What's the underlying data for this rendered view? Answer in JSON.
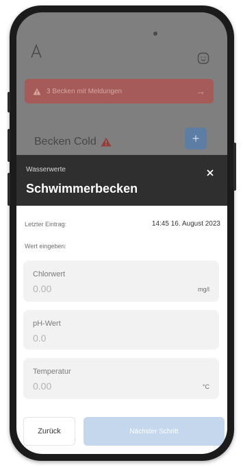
{
  "colors": {
    "accent": "#c5d7ec",
    "alert": "#a55b58",
    "header": "#2f2f2f",
    "field_bg": "#f2f2f2"
  },
  "background": {
    "logo_icon": "brand-logo-icon",
    "avatar_icon": "avatar-icon",
    "alert_text": "3 Becken mit Meldungen",
    "alert_arrow": "→",
    "pool_name": "Becken Cold",
    "add_label": "+"
  },
  "sheet": {
    "subtitle": "Wasserwerte",
    "title": "Schwimmerbecken",
    "close_icon": "close-icon",
    "last_entry_label": "Letzter Eintrag:",
    "last_entry_value": "14:45 16. August 2023",
    "enter_value_label": "Wert eingeben:",
    "fields": [
      {
        "label": "Chlorwert",
        "value": "0.00",
        "unit": "mg/l"
      },
      {
        "label": "pH-Wert",
        "value": "0.0",
        "unit": ""
      },
      {
        "label": "Temperatur",
        "value": "0.00",
        "unit": "°C"
      }
    ],
    "back_label": "Zurück",
    "next_label": "Nächster Schritt"
  }
}
